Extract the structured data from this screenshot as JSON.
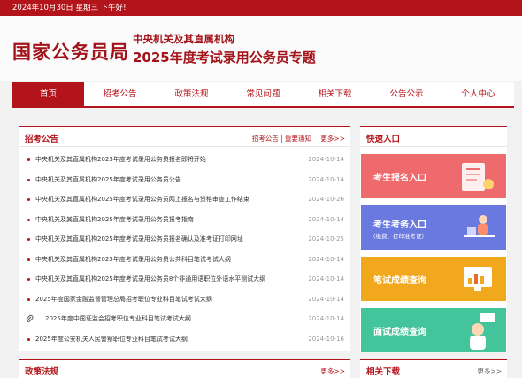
{
  "topbar": {
    "date_text": "2024年10月30日  星期三  下午好!"
  },
  "header": {
    "logo": "国家公务员局",
    "subtitle_line1": "中央机关及其直属机构",
    "subtitle_line2": "2025年度考试录用公务员专题"
  },
  "nav": {
    "items": [
      {
        "label": "首页"
      },
      {
        "label": "招考公告"
      },
      {
        "label": "政策法规"
      },
      {
        "label": "常见问题"
      },
      {
        "label": "相关下载"
      },
      {
        "label": "公告公示"
      },
      {
        "label": "个人中心"
      }
    ]
  },
  "announcements": {
    "title": "招考公告",
    "tags": "招考公告 | 重要通知",
    "more": "更多>>",
    "items": [
      {
        "title": "中央机关及其直属机构2025年度考试录用公务员报名即将开始",
        "date": "2024-10-14"
      },
      {
        "title": "中央机关及其直属机构2025年度考试录用公务员公告",
        "date": "2024-10-14"
      },
      {
        "title": "中央机关及其直属机构2025年度考试录用公务员网上报名与资格审查工作结束",
        "date": "2024-10-26"
      },
      {
        "title": "中央机关及其直属机构2025年度考试录用公务员报考指南",
        "date": "2024-10-14"
      },
      {
        "title": "中央机关及其直属机构2025年度考试录用公务员报名确认及准考证打印网址",
        "date": "2024-10-25"
      },
      {
        "title": "中央机关及其直属机构2025年度考试录用公务员公共科目笔试考试大纲",
        "date": "2024-10-14"
      },
      {
        "title": "中央机关及其直属机构2025年度考试录用公务员8个非通用语职位外语水平测试大纲",
        "date": "2024-10-14"
      },
      {
        "title": "2025年度国家金融监督管理总局招考职位专业科目笔试考试大纲",
        "date": "2024-10-14"
      },
      {
        "title": "2025年度中国证监会招考职位专业科目笔试考试大纲",
        "date": "2024-10-14"
      },
      {
        "title": "2025年度公安机关人民警察职位专业科目笔试考试大纲",
        "date": "2024-10-16"
      }
    ]
  },
  "quick_entry": {
    "title": "快速入口",
    "items": [
      {
        "label": "考生报名入口"
      },
      {
        "label": "考生考务入口",
        "sub": "（缴费、打印准考证）"
      },
      {
        "label": "笔试成绩查询"
      },
      {
        "label": "面试成绩查询"
      }
    ],
    "colors": {
      "register": "#ef6a6d",
      "affairs": "#6a79e0",
      "written": "#f2a81c",
      "interview": "#43c49a"
    }
  },
  "policy": {
    "title": "政策法规",
    "more": "更多>>"
  },
  "downloads": {
    "title": "相关下载",
    "more": "更多>>"
  },
  "theme": {
    "accent": "#b3141b"
  }
}
